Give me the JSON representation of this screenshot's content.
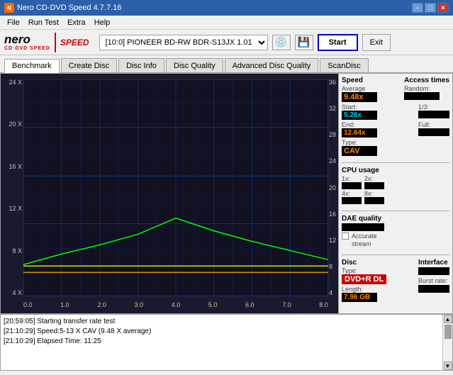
{
  "titlebar": {
    "title": "Nero CD-DVD Speed 4.7.7.16",
    "icon": "N",
    "minimize": "−",
    "maximize": "□",
    "close": "✕"
  },
  "menubar": {
    "items": [
      "File",
      "Run Test",
      "Extra",
      "Help"
    ]
  },
  "toolbar": {
    "logo_nero": "nero",
    "logo_sub": "CD·DVD SPEED",
    "drive_value": "[10:0]  PIONEER BD-RW  BDR-S13JX 1.01",
    "start_label": "Start",
    "exit_label": "Exit"
  },
  "tabs": {
    "items": [
      "Benchmark",
      "Create Disc",
      "Disc Info",
      "Disc Quality",
      "Advanced Disc Quality",
      "ScanDisc"
    ],
    "active": "Benchmark"
  },
  "chart": {
    "y_labels_left": [
      "24 X",
      "20 X",
      "16 X",
      "12 X",
      "8 X",
      "4 X"
    ],
    "y_labels_right": [
      "36",
      "32",
      "28",
      "24",
      "20",
      "16",
      "12",
      "8",
      "4"
    ],
    "x_labels": [
      "0.0",
      "1.0",
      "2.0",
      "3.0",
      "4.0",
      "5.0",
      "6.0",
      "7.0",
      "8.0"
    ]
  },
  "side_panel": {
    "speed_label": "Speed",
    "average_label": "Average",
    "average_value": "9.48x",
    "start_label": "Start:",
    "start_value": "5.26x",
    "end_label": "End:",
    "end_value": "12.64x",
    "type_label": "Type:",
    "type_value": "CAV",
    "access_label": "Access times",
    "random_label": "Random:",
    "random_value": "",
    "one_third_label": "1/3:",
    "one_third_value": "",
    "full_label": "Full:",
    "full_value": "",
    "cpu_label": "CPU usage",
    "cpu_1x_label": "1x:",
    "cpu_1x_value": "",
    "cpu_2x_label": "2x:",
    "cpu_2x_value": "",
    "cpu_4x_label": "4x:",
    "cpu_4x_value": "",
    "cpu_8x_label": "8x:",
    "cpu_8x_value": "",
    "dae_label": "DAE quality",
    "dae_value": "",
    "accurate_label": "Accurate",
    "stream_label": "stream",
    "disc_label": "Disc",
    "disc_type_label": "Type:",
    "disc_type_value": "DVD+R DL",
    "length_label": "Length:",
    "length_value": "7.96 GB",
    "interface_label": "Interface",
    "burst_label": "Burst rate:"
  },
  "log": {
    "rows": [
      "[20:59:05]  Starting transfer rate test",
      "[21:10:29]  Speed:5-13 X CAV (9.48 X average)",
      "[21:10:29]  Elapsed Time: 11:25"
    ]
  }
}
